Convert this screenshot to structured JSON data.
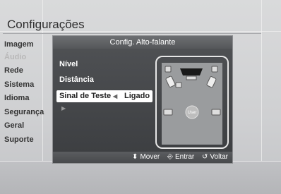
{
  "screen": {
    "title": "Configurações"
  },
  "menu": {
    "items": [
      {
        "label": "Imagem",
        "active": false
      },
      {
        "label": "Áudio",
        "active": true
      },
      {
        "label": "Rede",
        "active": false
      },
      {
        "label": "Sistema",
        "active": false
      },
      {
        "label": "Idioma",
        "active": false
      },
      {
        "label": "Segurança",
        "active": false
      },
      {
        "label": "Geral",
        "active": false
      },
      {
        "label": "Suporte",
        "active": false
      }
    ]
  },
  "dialog": {
    "title": "Config. Alto-falante",
    "options": {
      "nivel": "Nível",
      "distancia": "Distância",
      "sinal_teste": "Sinal de Teste",
      "sinal_teste_value": "Ligado"
    },
    "diagram": {
      "user_label": "User"
    },
    "footer": {
      "move": "Mover",
      "enter": "Entrar",
      "back": "Voltar"
    }
  },
  "colors": {
    "background": "#d0d1d3",
    "dialog_body": "#45474a",
    "highlight": "#ffffff"
  }
}
